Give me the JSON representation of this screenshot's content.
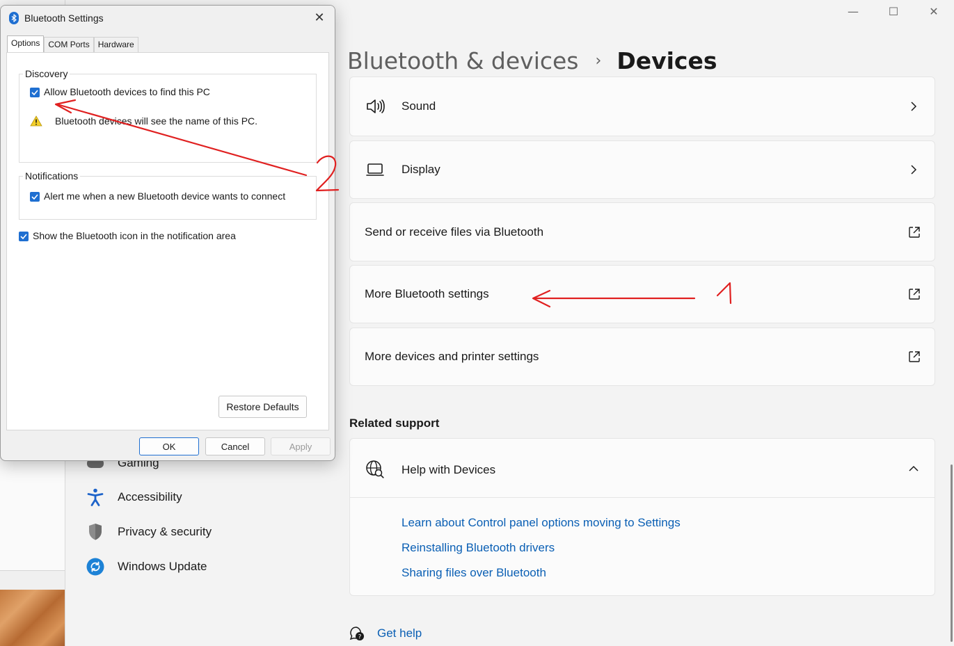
{
  "settings": {
    "window_controls": {
      "minimize": "—",
      "maximize": "☐",
      "close": "✕"
    },
    "breadcrumb": {
      "parent": "Bluetooth & devices",
      "separator": "›",
      "current": "Devices"
    },
    "cards": [
      {
        "label": "Sound",
        "icon": "speaker-icon",
        "action": "chevron"
      },
      {
        "label": "Display",
        "icon": "laptop-icon",
        "action": "chevron"
      },
      {
        "label": "Send or receive files via Bluetooth",
        "action": "external"
      },
      {
        "label": "More Bluetooth settings",
        "action": "external"
      },
      {
        "label": "More devices and printer settings",
        "action": "external"
      }
    ],
    "related_support": {
      "title": "Related support",
      "help_title": "Help with Devices",
      "links": [
        "Learn about Control panel options moving to Settings",
        "Reinstalling Bluetooth drivers",
        "Sharing files over Bluetooth"
      ]
    },
    "get_help": "Get help",
    "nav": [
      {
        "label": "Gaming",
        "icon": "gaming-icon"
      },
      {
        "label": "Accessibility",
        "icon": "accessibility-icon"
      },
      {
        "label": "Privacy & security",
        "icon": "shield-icon"
      },
      {
        "label": "Windows Update",
        "icon": "update-icon"
      }
    ]
  },
  "dialog": {
    "title": "Bluetooth Settings",
    "close": "✕",
    "tabs": [
      "Options",
      "COM Ports",
      "Hardware"
    ],
    "discovery": {
      "title": "Discovery",
      "allow_label": "Allow Bluetooth devices to find this PC",
      "allow_checked": true,
      "warning": "Bluetooth devices will see the name of this PC."
    },
    "notifications": {
      "title": "Notifications",
      "alert_label": "Alert me when a new Bluetooth device wants to connect",
      "alert_checked": true
    },
    "show_icon_label": "Show the Bluetooth icon in the notification area",
    "show_icon_checked": true,
    "restore_defaults": "Restore Defaults",
    "ok": "OK",
    "cancel": "Cancel",
    "apply": "Apply"
  },
  "annotations": {
    "one": "1",
    "two": "2"
  },
  "colors": {
    "accent": "#1f6fd1",
    "link": "#0a5fb4",
    "annotation": "#e02020"
  }
}
